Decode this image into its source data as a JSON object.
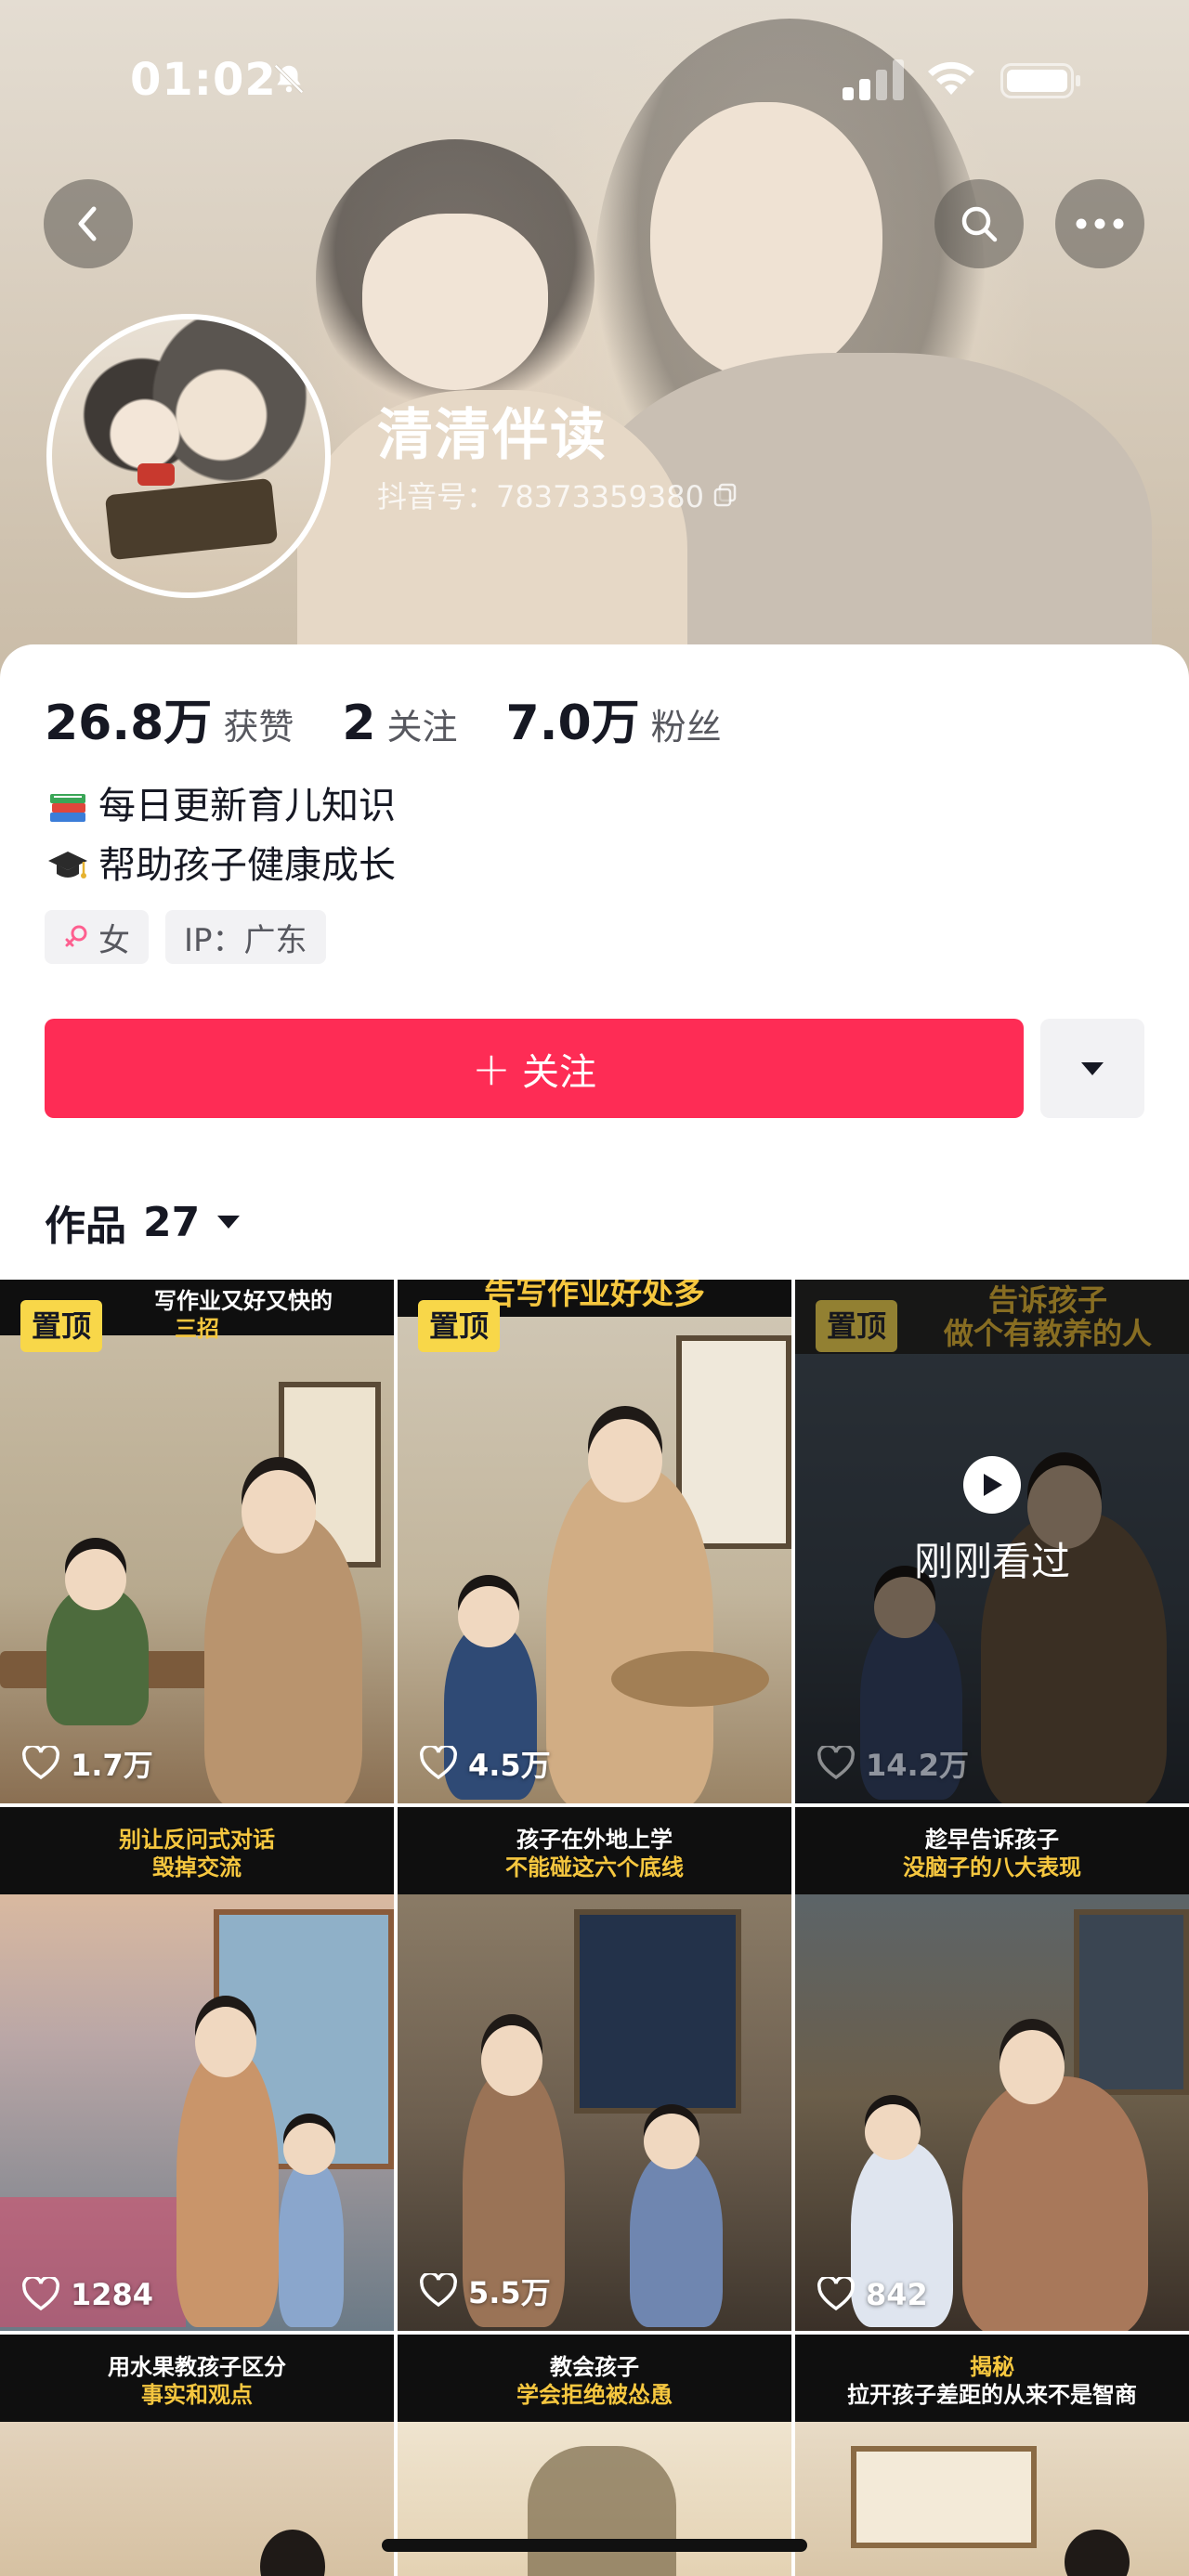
{
  "status_bar": {
    "time": "01:02"
  },
  "profile": {
    "name": "清清伴读",
    "douyin_id": "抖音号：78373359380",
    "stats": [
      {
        "value": "26.8万",
        "label": "获赞"
      },
      {
        "value": "2",
        "label": "关注"
      },
      {
        "value": "7.0万",
        "label": "粉丝"
      }
    ],
    "bio": [
      "每日更新育儿知识",
      "帮助孩子健康成长"
    ],
    "tags": {
      "gender": "女",
      "ip": "IP：广东"
    },
    "follow_label": "关注",
    "follow_plus": "+"
  },
  "works": {
    "label": "作品",
    "count": "27"
  },
  "pinned_label": "置顶",
  "watched_label": "刚刚看过",
  "videos": [
    {
      "cap1": "写作业又好又快的",
      "cap2": "三招",
      "likes": "1.7万",
      "pinned": true
    },
    {
      "cap1": "告写作业好处多",
      "cap2": "",
      "likes": "4.5万",
      "pinned": true
    },
    {
      "cap1": "告诉孩子",
      "cap2": "做个有教养的人",
      "likes": "14.2万",
      "pinned": true,
      "watched": true
    },
    {
      "cap1": "别让反问式对话",
      "cap2": "毁掉交流",
      "likes": "1284"
    },
    {
      "cap1": "孩子在外地上学",
      "cap2": "不能碰这六个底线",
      "likes": "5.5万"
    },
    {
      "cap1": "趁早告诉孩子",
      "cap2": "没脑子的八大表现",
      "likes": "842"
    },
    {
      "cap1": "用水果教孩子区分",
      "cap2": "事实和观点",
      "likes": ""
    },
    {
      "cap1": "教会孩子",
      "cap2": "学会拒绝被怂恿",
      "likes": ""
    },
    {
      "cap1": "揭秘",
      "cap2": "拉开孩子差距的从来不是智商",
      "likes": ""
    }
  ],
  "colors": {
    "accent": "#fe2c55",
    "pin": "#f8d749",
    "caption_yellow": "#f6c73f"
  }
}
